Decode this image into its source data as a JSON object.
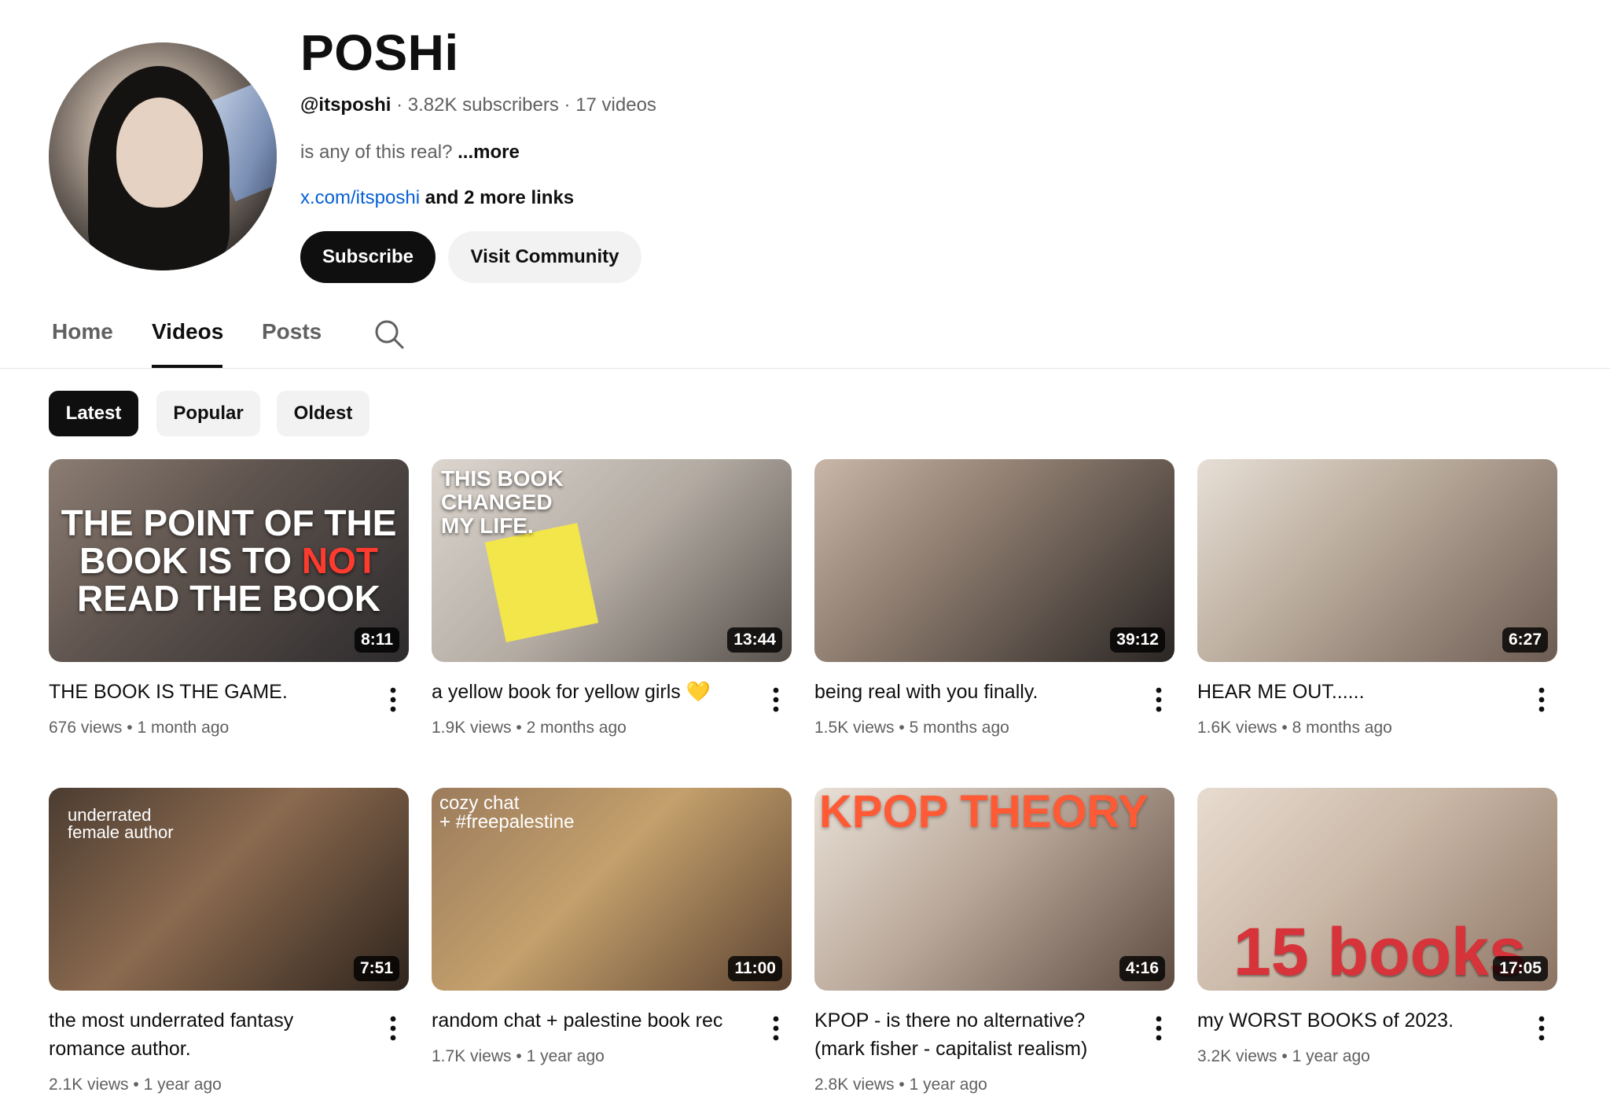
{
  "channel": {
    "name": "POSHi",
    "handle": "@itsposhi",
    "sep1": "·",
    "subscribers": "3.82K subscribers",
    "sep2": "·",
    "videos": "17 videos",
    "description": "is any of this real?",
    "more": "...more",
    "link": "x.com/itsposhi",
    "more_links": "and 2 more links",
    "subscribe_label": "Subscribe",
    "community_label": "Visit Community"
  },
  "tabs": [
    {
      "label": "Home"
    },
    {
      "label": "Videos"
    },
    {
      "label": "Posts"
    }
  ],
  "filters": [
    {
      "label": "Latest"
    },
    {
      "label": "Popular"
    },
    {
      "label": "Oldest"
    }
  ],
  "videos": [
    {
      "title": "THE BOOK IS THE GAME.",
      "views": "676 views",
      "age": "1 month ago",
      "duration": "8:11",
      "thumb_text": [
        "THE POINT OF THE",
        "BOOK IS TO",
        "NOT",
        "READ THE BOOK"
      ]
    },
    {
      "title": "a yellow book for yellow girls 💛",
      "views": "1.9K views",
      "age": "2 months ago",
      "duration": "13:44",
      "thumb_text": [
        "THIS BOOK",
        "CHANGED",
        "MY LIFE."
      ]
    },
    {
      "title": "being real with you finally.",
      "views": "1.5K views",
      "age": "5 months ago",
      "duration": "39:12"
    },
    {
      "title": "HEAR ME OUT......",
      "views": "1.6K views",
      "age": "8 months ago",
      "duration": "6:27"
    },
    {
      "title_line1": "the most underrated fantasy",
      "title_line2": "romance author.",
      "views": "2.1K views",
      "age": "1 year ago",
      "duration": "7:51",
      "thumb_text": [
        "underrated",
        "female author"
      ]
    },
    {
      "title": "random chat + palestine book rec",
      "views": "1.7K views",
      "age": "1 year ago",
      "duration": "11:00",
      "thumb_text": [
        "cozy chat",
        "+ #freepalestine"
      ]
    },
    {
      "title_line1": "KPOP - is there no alternative?",
      "title_line2": "(mark fisher - capitalist realism)",
      "views": "2.8K views",
      "age": "1 year ago",
      "duration": "4:16",
      "thumb_text": "KPOP THEORY"
    },
    {
      "title": "my WORST BOOKS of 2023.",
      "views": "3.2K views",
      "age": "1 year ago",
      "duration": "17:05",
      "thumb_text": "15 books"
    }
  ],
  "stat_separator": "•"
}
